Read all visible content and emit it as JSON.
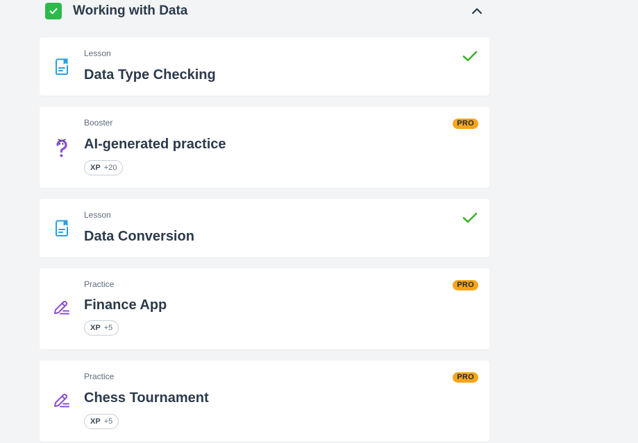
{
  "section": {
    "title": "Working with Data",
    "completed": true
  },
  "items": [
    {
      "type": "Lesson",
      "title": "Data Type Checking",
      "icon": "lesson-icon",
      "completed": true
    },
    {
      "type": "Booster",
      "title": "AI-generated practice",
      "icon": "question-icon",
      "badge": "PRO",
      "xp_label": "XP",
      "xp_value": "+20"
    },
    {
      "type": "Lesson",
      "title": "Data Conversion",
      "icon": "lesson-icon",
      "completed": true
    },
    {
      "type": "Practice",
      "title": "Finance App",
      "icon": "pencil-icon",
      "badge": "PRO",
      "xp_label": "XP",
      "xp_value": "+5"
    },
    {
      "type": "Practice",
      "title": "Chess Tournament",
      "icon": "pencil-icon",
      "badge": "PRO",
      "xp_label": "XP",
      "xp_value": "+5"
    }
  ],
  "colors": {
    "background": "#f2f4f6",
    "section_check": "#2bbb4b",
    "done_check": "#3fb02a",
    "pro_badge": "#f7a51b",
    "lesson_icon": "#2a9fe0",
    "practice_icon": "#8a4fd6"
  }
}
